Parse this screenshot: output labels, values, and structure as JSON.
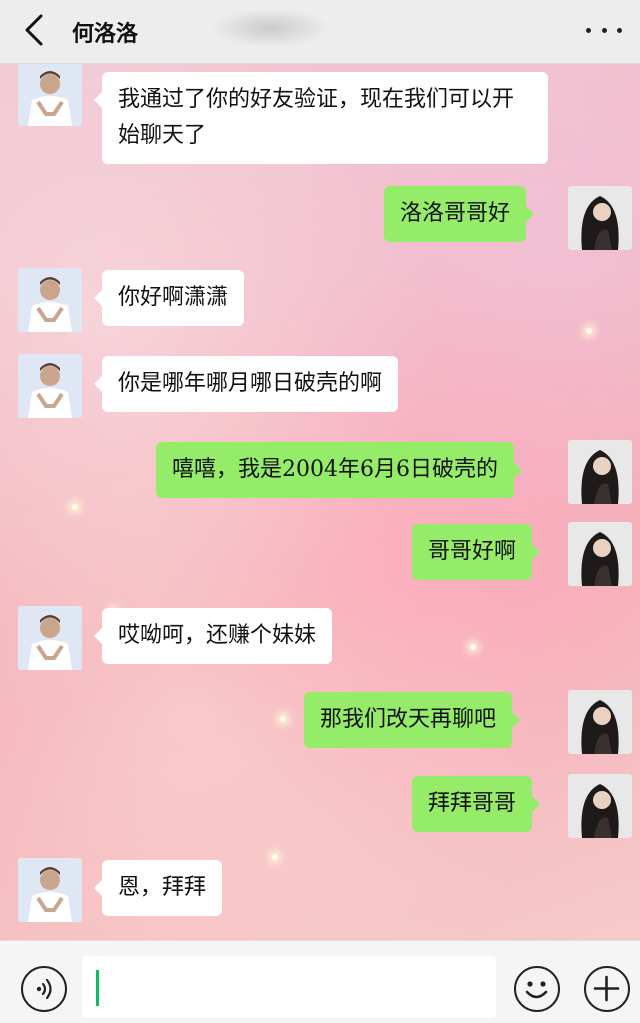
{
  "header": {
    "title": "何洛洛",
    "back_icon": "chevron-left-icon",
    "more_icon": "more-dots-icon"
  },
  "messages": [
    {
      "side": "in",
      "text": "我通过了你的好友验证，现在我们可以开始聊天了"
    },
    {
      "side": "out",
      "text": "洛洛哥哥好"
    },
    {
      "side": "in",
      "text": "你好啊潇潇"
    },
    {
      "side": "in",
      "text": "你是哪年哪月哪日破壳的啊"
    },
    {
      "side": "out",
      "text": "嘻嘻，我是2004年6月6日破壳的"
    },
    {
      "side": "out",
      "text": "哥哥好啊"
    },
    {
      "side": "in",
      "text": "哎呦呵，还赚个妹妹"
    },
    {
      "side": "out",
      "text": "那我们改天再聊吧"
    },
    {
      "side": "out",
      "text": "拜拜哥哥"
    },
    {
      "side": "in",
      "text": "恩，拜拜"
    }
  ],
  "input_bar": {
    "value": "",
    "voice_icon": "voice-icon",
    "emoji_icon": "emoji-icon",
    "plus_icon": "plus-icon"
  },
  "colors": {
    "incoming_bubble": "#ffffff",
    "outgoing_bubble": "#95ec69",
    "caret": "#07c160",
    "header_bg": "#ededed"
  }
}
